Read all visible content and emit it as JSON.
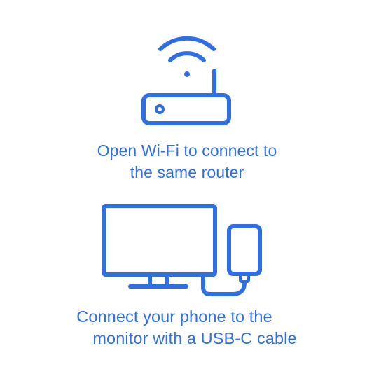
{
  "steps": [
    {
      "icon": "wifi-router-icon",
      "lines": [
        "Open Wi-Fi to connect to",
        "the same router"
      ]
    },
    {
      "icon": "monitor-phone-usb-icon",
      "lines": [
        "Connect your phone to the",
        "monitor with a USB-C cable"
      ]
    }
  ],
  "colors": {
    "accent": "#2f6fe6",
    "background": "#ffffff"
  }
}
